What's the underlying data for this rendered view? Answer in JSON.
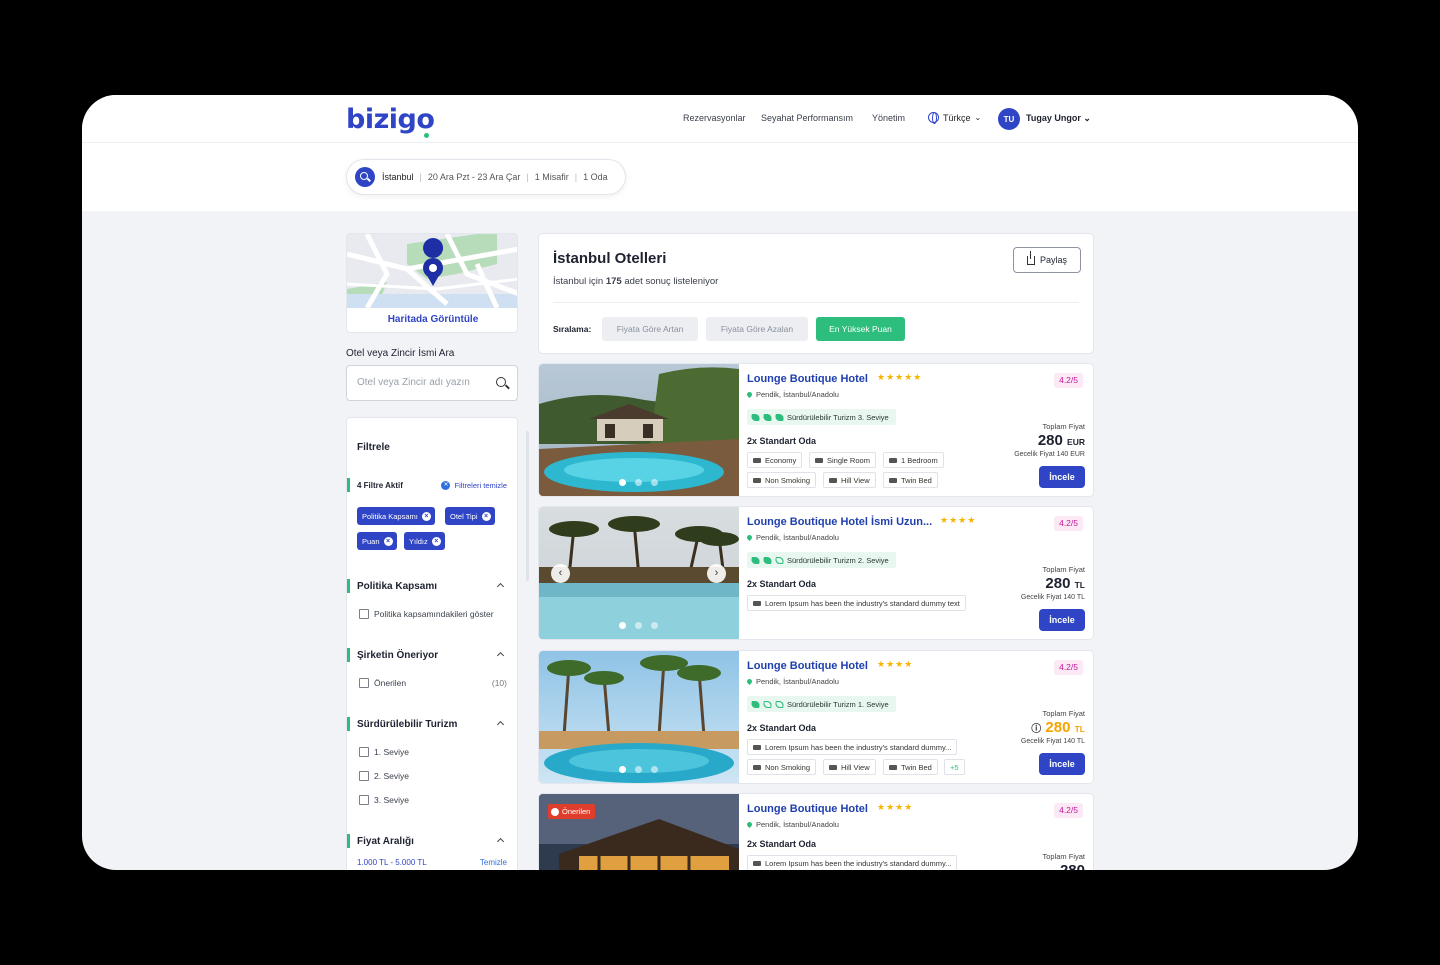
{
  "header": {
    "logo": "bizigo",
    "nav": [
      "Rezervasyonlar",
      "Seyahat Performansım",
      "Yönetim"
    ],
    "language": "Türkçe",
    "user_initials": "TU",
    "user_name": "Tugay Ungor"
  },
  "search": {
    "city": "İstanbul",
    "dates": "20 Ara Pzt - 23 Ara Çar",
    "guests": "1 Misafir",
    "rooms": "1 Oda"
  },
  "sidebar": {
    "map_link": "Haritada Görüntüle",
    "search_label": "Otel veya Zincir İsmi Ara",
    "search_placeholder": "Otel veya Zincir adı yazın",
    "filters_title": "Filtrele",
    "active_filters": "4 Filtre Aktif",
    "clear_filters": "Filtreleri temizle",
    "chips": [
      "Politika Kapsamı",
      "Otel Tipi",
      "Puan",
      "Yıldız"
    ],
    "sections": {
      "policy": {
        "title": "Politika Kapsamı",
        "option": "Politika kapsamındakileri göster"
      },
      "company": {
        "title": "Şirketin Öneriyor",
        "option": "Önerilen",
        "count": "(10)"
      },
      "sustainable": {
        "title": "Sürdürülebilir Turizm",
        "options": [
          "1. Seviye",
          "2. Seviye",
          "3. Seviye"
        ]
      },
      "price": {
        "title": "Fiyat Aralığı",
        "range": "1.000 TL - 5.000 TL",
        "clear": "Temizle"
      }
    }
  },
  "results": {
    "title": "İstanbul Otelleri",
    "subtitle_pre": "İstanbul için",
    "subtitle_count": "175",
    "subtitle_post": "adet sonuç listeleniyor",
    "share": "Paylaş",
    "sort_label": "Sıralama:",
    "sort_options": [
      "Fiyata Göre Artan",
      "Fiyata Göre Azalan",
      "En Yüksek Puan"
    ],
    "sort_active": "En Yüksek Puan"
  },
  "hotels": [
    {
      "name": "Lounge Boutique Hotel",
      "stars": "★★★★★",
      "location": "Pendik, İstanbul/Anadolu",
      "eco": "Sürdürülebilir Turizm 3. Seviye",
      "room": "2x Standart Oda",
      "tags1": [
        "Economy",
        "Single Room",
        "1 Bedroom"
      ],
      "tags2": [
        "Non Smoking",
        "Hill View",
        "Twin Bed"
      ],
      "rating": "4.2/5",
      "total_label": "Toplam Fiyat",
      "price": "280",
      "currency": "EUR",
      "nightly": "Gecelik Fiyat 140 EUR",
      "cta": "İncele"
    },
    {
      "name": "Lounge Boutique Hotel İsmi Uzun...",
      "stars": "★★★★",
      "location": "Pendik, İstanbul/Anadolu",
      "eco": "Sürdürülebilir Turizm 2. Seviye",
      "room": "2x Standart Oda",
      "tags1": [
        "Lorem Ipsum has been the industry's standard dummy text"
      ],
      "rating": "4.2/5",
      "total_label": "Toplam Fiyat",
      "price": "280",
      "currency": "TL",
      "nightly": "Gecelik Fiyat 140 TL",
      "cta": "İncele"
    },
    {
      "name": "Lounge Boutique Hotel",
      "stars": "★★★★",
      "location": "Pendik, İstanbul/Anadolu",
      "eco": "Sürdürülebilir Turizm 1. Seviye",
      "room": "2x Standart Oda",
      "tags1": [
        "Lorem Ipsum has been the industry's standard dummy..."
      ],
      "tags2": [
        "Non Smoking",
        "Hill View",
        "Twin Bed",
        "+5"
      ],
      "rating": "4.2/5",
      "total_label": "Toplam Fiyat",
      "price": "280",
      "currency": "TL",
      "nightly": "Gecelik Fiyat 140 TL",
      "cta": "İncele"
    },
    {
      "badge": "Önerilen",
      "name": "Lounge Boutique Hotel",
      "stars": "★★★★",
      "location": "Pendik, İstanbul/Anadolu",
      "room": "2x Standart Oda",
      "tags1": [
        "Lorem Ipsum has been the industry's standard dummy..."
      ],
      "rating": "4.2/5",
      "total_label": "Toplam Fiyat",
      "price": "280"
    }
  ],
  "colors": {
    "brand": "#2f45c5",
    "green": "#2dbd7c",
    "rating": "#c2189a",
    "price_warn": "#f5a400"
  }
}
